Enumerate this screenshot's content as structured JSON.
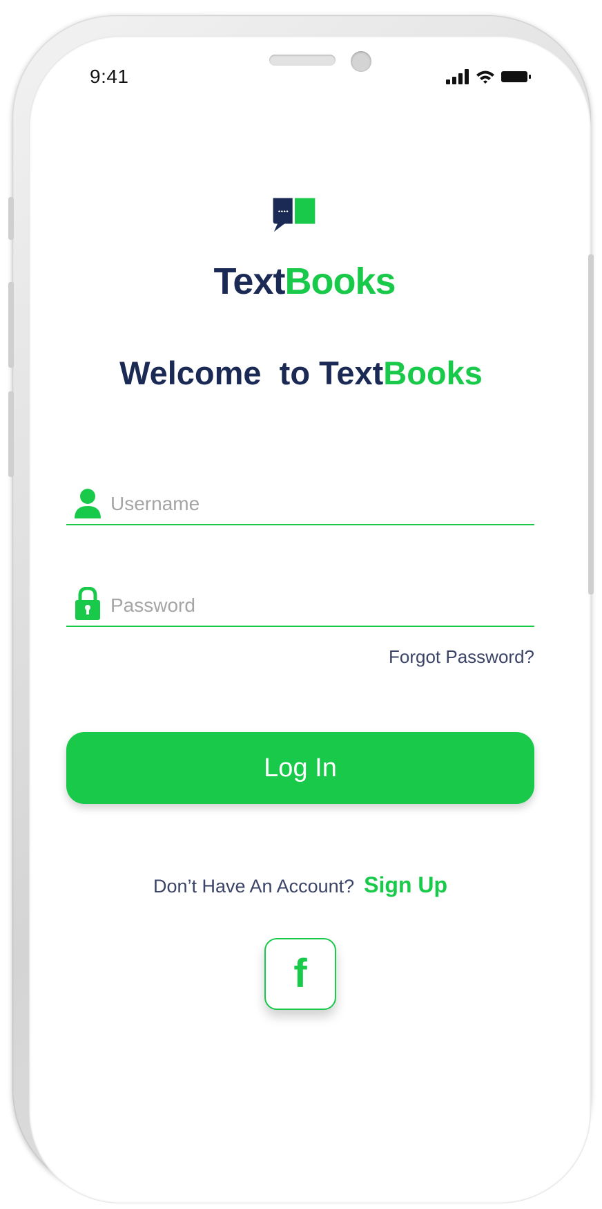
{
  "status_bar": {
    "time": "9:41"
  },
  "brand": {
    "name_part1": "Text",
    "name_part2": "Books"
  },
  "welcome": {
    "prefix": "Welcome  to Text",
    "suffix": "Books"
  },
  "username": {
    "placeholder": "Username",
    "value": ""
  },
  "password": {
    "placeholder": "Password",
    "value": ""
  },
  "forgot_password": "Forgot Password?",
  "login_button": "Log In",
  "signup": {
    "prompt": "Don’t Have An Account?",
    "link": "Sign Up"
  },
  "social": {
    "facebook_glyph": "f"
  },
  "colors": {
    "accent": "#18c94a",
    "navy": "#1b2a55",
    "text_muted": "#3b4467",
    "placeholder": "#a5a5a5"
  }
}
